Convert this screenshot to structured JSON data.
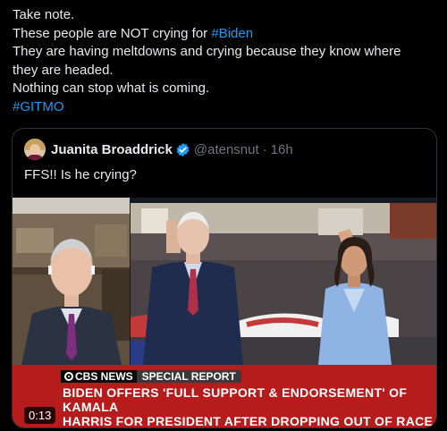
{
  "tweet": {
    "lines": [
      "Take note.",
      "These people are NOT crying for",
      "They are having meltdowns and crying because they know where",
      "they are headed.",
      "Nothing can stop what is coming."
    ],
    "inline_hashtag": "#Biden",
    "hashtag_line": "#GITMO"
  },
  "quote": {
    "author_name": "Juanita Broaddrick",
    "handle": "@atensnut",
    "separator": "·",
    "time": "16h",
    "text": "FFS!!   Is he crying?",
    "verified_icon": "verified-badge-icon"
  },
  "video": {
    "network": "CBS NEWS",
    "label": "SPECIAL REPORT",
    "headline_1": "BIDEN OFFERS 'FULL SUPPORT & ENDORSEMENT' OF KAMALA",
    "headline_2": "HARRIS FOR PRESIDENT AFTER DROPPING OUT OF RACE",
    "duration": "0:13"
  },
  "colors": {
    "link": "#1d9bf0",
    "verified": "#1d9bf0",
    "lower_third": "#b71c1c",
    "text": "#e7e9ea",
    "muted": "#71767b"
  }
}
